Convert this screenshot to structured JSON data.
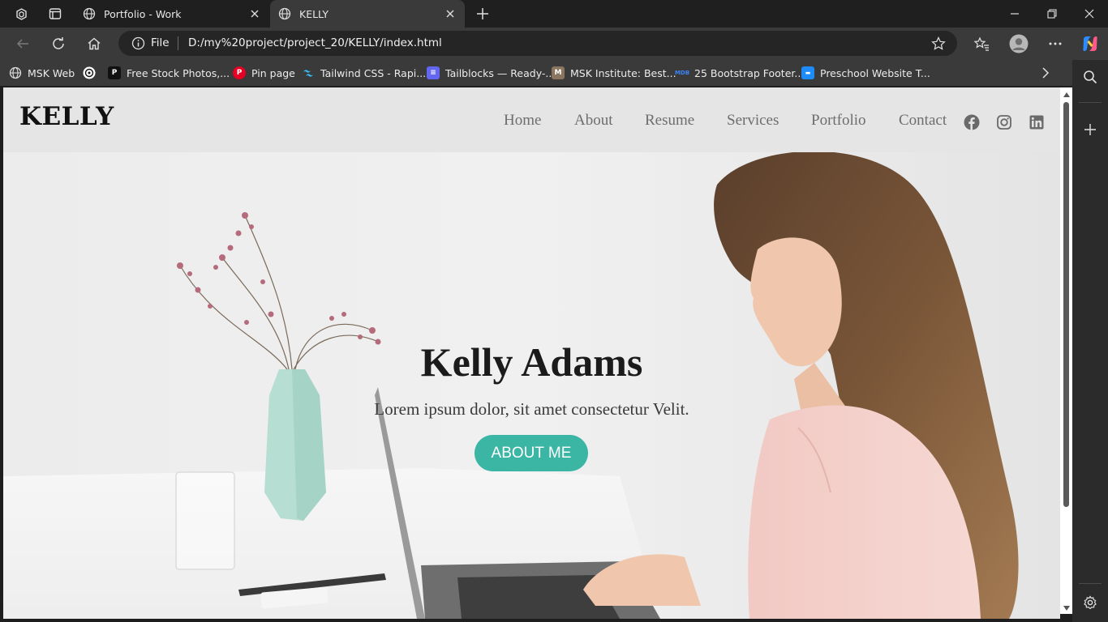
{
  "browser": {
    "tabs": [
      {
        "title": "Portfolio - Work",
        "icon": "globe-icon"
      },
      {
        "title": "KELLY",
        "icon": "globe-icon",
        "active": true
      }
    ],
    "omnibox": {
      "scheme_label": "File",
      "url": "D:/my%20project/project_20/KELLY/index.html"
    },
    "bookmarks": [
      {
        "label": "MSK Web",
        "icon": "globe-icon"
      },
      {
        "label": "",
        "icon": "openai-icon"
      },
      {
        "label": "Free Stock Photos,...",
        "icon": "pexels-icon"
      },
      {
        "label": "Pin page",
        "icon": "pinterest-icon"
      },
      {
        "label": "Tailwind CSS - Rapi...",
        "icon": "tailwind-icon"
      },
      {
        "label": "Tailblocks — Ready-...",
        "icon": "tailblocks-icon"
      },
      {
        "label": "MSK Institute: Best...",
        "icon": "msk-institute-icon"
      },
      {
        "label": "25 Bootstrap Footer...",
        "icon": "mdb-icon"
      },
      {
        "label": "Preschool Website T...",
        "icon": "preschool-icon"
      }
    ],
    "colors": {
      "accent_tab": "#3a3a3a",
      "toolbar": "#3a3a3a",
      "tabstrip": "#1f1f1f"
    }
  },
  "site": {
    "brand": "KELLY",
    "nav": [
      "Home",
      "About",
      "Resume",
      "Services",
      "Portfolio",
      "Contact"
    ],
    "social": [
      "facebook-icon",
      "instagram-icon",
      "linkedin-icon"
    ],
    "hero": {
      "title": "Kelly Adams",
      "subtitle": "Lorem ipsum dolor, sit amet consectetur Velit.",
      "button": "ABOUT ME"
    },
    "colors": {
      "button": "#3bb6a4",
      "nav_text": "#6d6d6d",
      "brand": "#111111"
    }
  }
}
